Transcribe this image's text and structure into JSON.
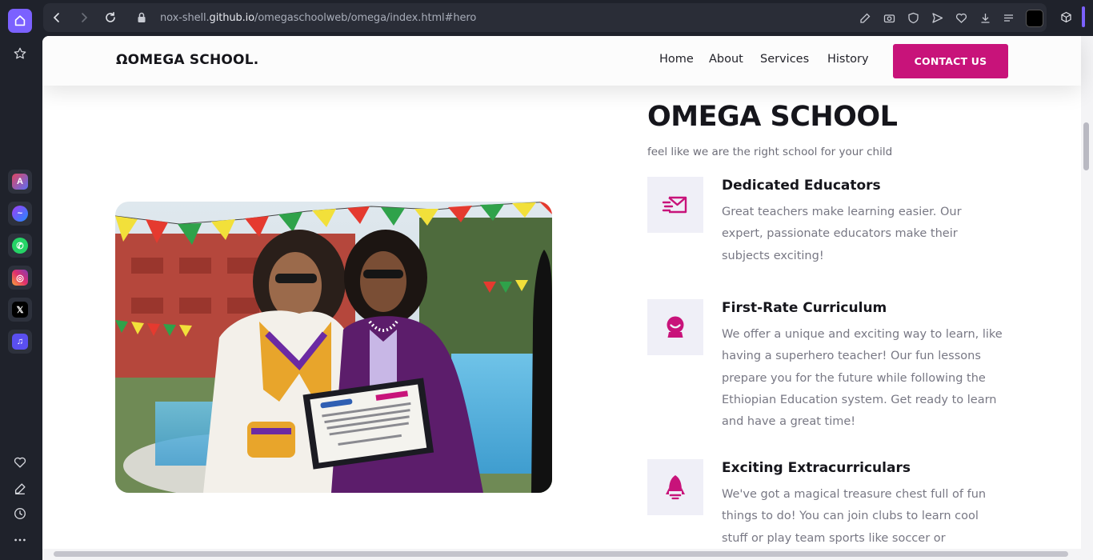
{
  "browser": {
    "url_prefix": "nox-shell.",
    "url_host": "github.io",
    "url_path": "/omegaschoolweb/omega/index.html#hero"
  },
  "site": {
    "logo": "ΩOMEGA SCHOOL.",
    "nav": [
      "Home",
      "About",
      "Services",
      "History"
    ],
    "cta": "CONTACT US"
  },
  "hero": {
    "title": "OMEGA SCHOOL",
    "subtitle": "feel like we are the right school for your child",
    "photo_icon": "award-ceremony-photo"
  },
  "features": [
    {
      "icon": "envelope-icon",
      "title": "Dedicated Educators",
      "lines": [
        "Great teachers make learning easier. Our",
        "expert, passionate educators make their",
        "subjects exciting!"
      ]
    },
    {
      "icon": "smiley-badge-icon",
      "title": "First-Rate Curriculum",
      "lines": [
        "We offer a unique and exciting way to learn, like",
        "having a superhero teacher! Our fun lessons",
        "prepare you for the future while following the",
        "Ethiopian Education system. Get ready to learn",
        "and have a great time!"
      ]
    },
    {
      "icon": "rocket-icon",
      "title": "Exciting Extracurriculars",
      "lines": [
        "We've got a magical treasure chest full of fun",
        "things to do! You can join clubs to learn cool",
        "stuff or play team sports like soccer or"
      ]
    }
  ],
  "colors": {
    "accent": "#c8137a",
    "icon_bg": "#efeff7",
    "browser_accent": "#7b61ff"
  }
}
